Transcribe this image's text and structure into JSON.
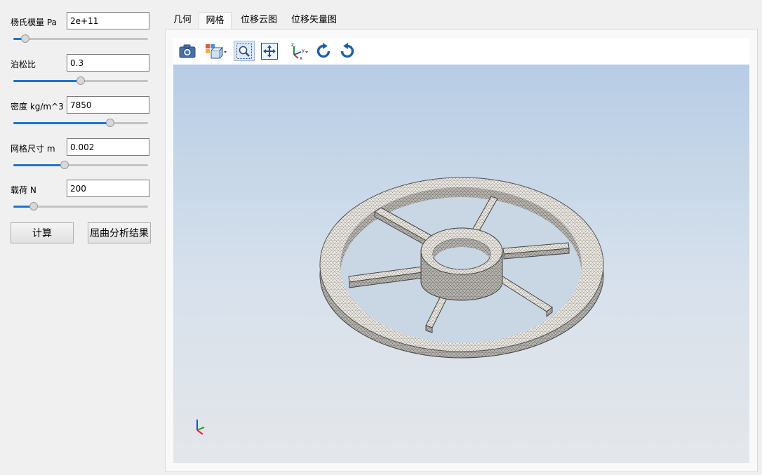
{
  "params": [
    {
      "label": "杨氏模量 Pa",
      "value": "2e+11",
      "slider": 0.09
    },
    {
      "label": "泊松比",
      "value": "0.3",
      "slider": 0.5
    },
    {
      "label": "密度 kg/m^3",
      "value": "7850",
      "slider": 0.72
    },
    {
      "label": "网格尺寸 m",
      "value": "0.002",
      "slider": 0.38
    },
    {
      "label": "载荷 N",
      "value": "200",
      "slider": 0.15
    }
  ],
  "buttons": {
    "compute": "计算",
    "buckling_result": "屈曲分析结果"
  },
  "tabs": [
    "几何",
    "网格",
    "位移云图",
    "位移矢量图"
  ],
  "active_tab": 1,
  "toolbar_icons": [
    "camera-icon",
    "view-cube-icon",
    "zoom-box-icon",
    "pan-icon",
    "axes-icon",
    "rotate-cw-icon",
    "rotate-ccw-icon"
  ],
  "colors": {
    "slider_fill": "#1976d2",
    "viewport_top": "#b7cde5",
    "viewport_bottom": "#e4e6ea",
    "mesh": "#ece8e0"
  }
}
